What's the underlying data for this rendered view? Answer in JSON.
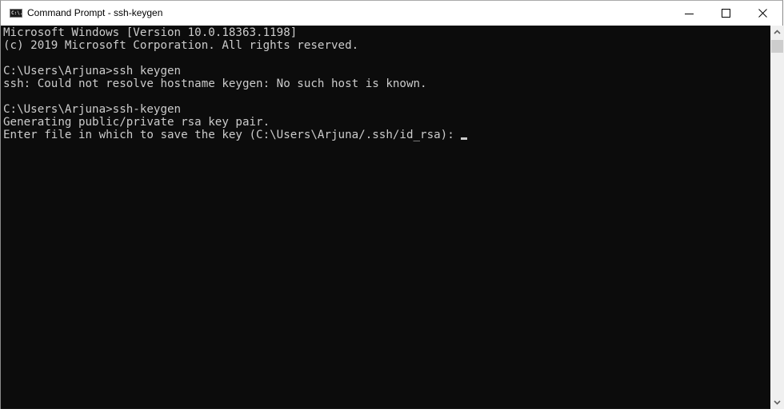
{
  "window": {
    "title": "Command Prompt - ssh-keygen",
    "app_icon": "command-prompt-icon",
    "app_icon_text": "C:\\.",
    "controls": [
      "minimize",
      "maximize",
      "close"
    ]
  },
  "terminal": {
    "lines": [
      "Microsoft Windows [Version 10.0.18363.1198]",
      "(c) 2019 Microsoft Corporation. All rights reserved.",
      "",
      "C:\\Users\\Arjuna>ssh keygen",
      "ssh: Could not resolve hostname keygen: No such host is known.",
      "",
      "C:\\Users\\Arjuna>ssh-keygen",
      "Generating public/private rsa key pair.",
      "Enter file in which to save the key (C:\\Users\\Arjuna/.ssh/id_rsa):"
    ],
    "colors": {
      "background": "#0c0c0c",
      "text": "#cccccc"
    }
  }
}
